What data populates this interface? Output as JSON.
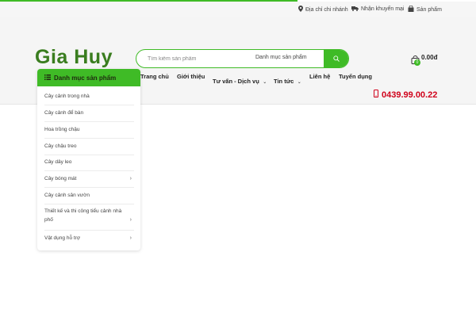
{
  "topbar": {
    "branch": "Địa chỉ chi nhánh",
    "promo": "Nhận khuyến mại",
    "products": "Sản phẩm"
  },
  "header": {
    "logo": "Gia Huy",
    "search_placeholder": "Tìm kiếm sản phẩm",
    "search_category": "Danh mục sản phẩm",
    "cart_count": "0",
    "cart_total": "0.00đ"
  },
  "nav": {
    "items": [
      "Trang chủ",
      "Giới thiệu",
      "Tư vấn - Dịch vụ",
      "Tin tức",
      "Liên hệ",
      "Tuyển dụng"
    ]
  },
  "phone": "0439.99.00.22",
  "category_menu": {
    "title": "Danh mục sản phẩm",
    "items": [
      "Cây cảnh trong nhà",
      "Cây cảnh để bàn",
      "Hoa trồng chậu",
      "Cây chậu treo",
      "Cây dây leo",
      "Cây bóng mát",
      "Cây cảnh sân vườn",
      "Thiết kế và thi công tiểu cảnh nhà phố",
      "Vật dụng hỗ trợ"
    ]
  },
  "colors": {
    "accent": "#3fbb26",
    "logo": "#3a7d1f",
    "phone": "#d0021b"
  }
}
